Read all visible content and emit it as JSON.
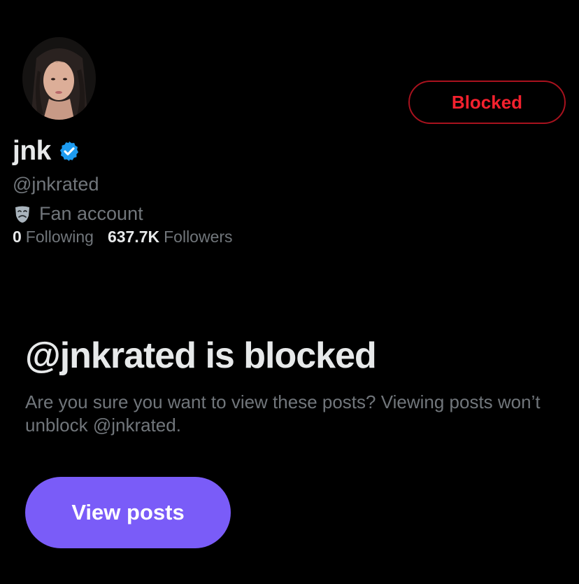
{
  "profile": {
    "display_name": "jnk",
    "handle": "@jnkrated",
    "verified": true,
    "bio": "Fan account",
    "bio_icon": "theater-mask-icon",
    "avatar_icon": "profile-photo"
  },
  "stats": {
    "following_count": "0",
    "following_label": "Following",
    "followers_count": "637.7K",
    "followers_label": "Followers"
  },
  "actions": {
    "blocked_label": "Blocked",
    "view_posts_label": "View posts"
  },
  "blocked_notice": {
    "title": "@jnkrated is blocked",
    "description": "Are you sure you want to view these posts? Viewing posts won’t unblock @jnkrated."
  },
  "colors": {
    "background": "#000000",
    "blocked_red": "#f4212e",
    "verified_blue": "#1d9bf0",
    "view_posts_purple": "#7a5cf8",
    "secondary_text": "#71767b",
    "primary_text": "#e7e9ea"
  }
}
